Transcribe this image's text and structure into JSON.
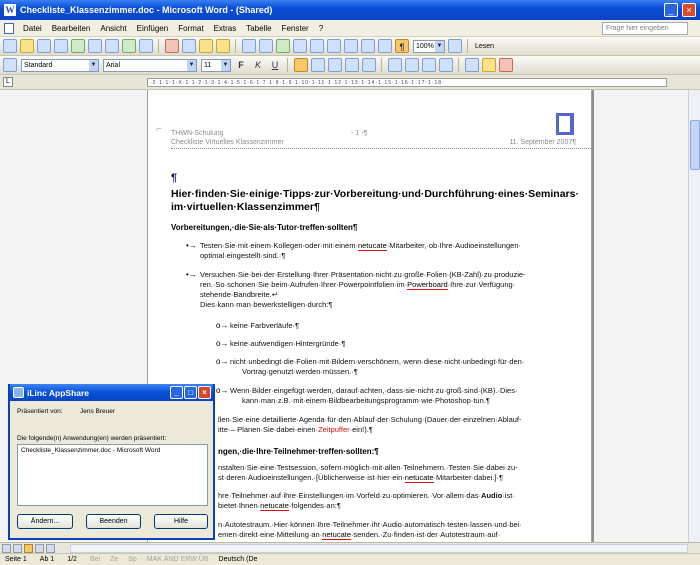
{
  "window": {
    "title": "Checkliste_Klassenzimmer.doc - Microsoft Word - (Shared)",
    "min_label": "_",
    "close_label": "×"
  },
  "menu": {
    "items": [
      "Datei",
      "Bearbeiten",
      "Ansicht",
      "Einfügen",
      "Format",
      "Extras",
      "Tabelle",
      "Fenster",
      "?"
    ],
    "help_placeholder": "Frage hier eingeben"
  },
  "toolbar": {
    "zoom": "100%",
    "read_label": "Lesen",
    "style": "Standard",
    "font": "Arial",
    "size": "11",
    "bold_label": "F",
    "italic_label": "K",
    "underline_label": "U"
  },
  "ruler": {
    "scale": "·2·1·1·1·X·1·1·2·1·3·1·4·1·5·1·6·1·7·1·8·1·9·1·10·1·11·1·12·1·13·1·14·1·15·1·16·1·17·1·18·"
  },
  "document": {
    "header_left1": "THWN-Schulung",
    "header_center1": "- 1 -¶",
    "header_left2": "Checkliste Virtuelles Klassenzimmer",
    "header_right2": "11. September 2007¶",
    "pilcrow": "¶",
    "heading": "Hier·finden·Sie·einige·Tipps·zur·Vorbereitung·und·Durchführung·eines·Seminars· im·virtuellen·Klassenzimmer¶",
    "section1": "Vorbereitungen,·die·Sie·als·Tutor·treffen·sollten¶",
    "b1_line1": "Testen·Sie·mit·einem·Kollegen·oder·mit·einem·",
    "b1_ul": "netucate",
    "b1_line1b": "·Mitarbeiter,·ob·Ihre·Audioeinstellungen·",
    "b1_line2": "optimal·eingestellt·sind.·¶",
    "b2_line1": "Versuchen·Sie·bei·der·Erstellung·Ihrer·Präsentation·nicht·zu·große·Folien·(KB-Zahl)·zu·produzie-",
    "b2_line2a": "ren.·So·schonen·Sie·beim·Aufrufen·Ihrer·Powerpointfolien·im·",
    "b2_ul": "Powerboard",
    "b2_line2b": "·Ihre·zur·Verfügung·",
    "b2_line3": "stehende·Bandbreite.↵",
    "b2_line4": "Dies·kann·man·bewerkstelligen·durch:¶",
    "s1": "keine·Farbverläufe·¶",
    "s2": "keine·aufwendigen·Hintergründe·¶",
    "s3_line1": "nicht·unbedingt·die·Folien·mit·Bildern·verschönern,·wenn·diese·nicht·unbedingt·für·den·",
    "s3_line2": "Vortrag·genutzt·werden·müssen.·¶",
    "s4_line1": "Wenn·Bilder·eingefügt·werden,·darauf·achten,·dass·sie·nicht·zu·groß·sind·(KB).·Dies·",
    "s4_line2": "kann·man·z.B.·mit·einem·Bildbearbeitungsprogramm·wie·Photoshop·tun.¶",
    "p1_line1": "llen·Sie·eine·detaillierte·Agenda·für·den·Ablauf·der·Schulung·(Dauer·der·einzelnen·Ablauf-",
    "p1_line2a": "itte·–·Planen·Sie·dabei·einen·",
    "p1_red": "Zeitpuffer",
    "p1_line2b": "·ein!).¶",
    "section2": "ngen,·die·Ihre·Teilnehmer·treffen·sollten:¶",
    "p2_line1": "nstalten·Sie·eine·Testsession,·sofern·möglich·mit·allen·Teilnehmern.·Testen·Sie·dabei·zu-",
    "p2_line2a": "st·deren·Audioeinstellungen.·[Üblicherweise·ist·hier·ein·",
    "p2_ul": "netucate",
    "p2_line2b": "·Mitarbeiter·dabei.]·¶",
    "p3_line1a": "hre·Teilnehmer·auf·ihre·Einstellungen·im·Vorfeld·zu·optimieren.·Vor·allem·das·",
    "p3_bold": "Audio",
    "p3_line1b": "·ist·",
    "p3_line2a": "bietet·Ihnen·",
    "p3_ul": "netucate",
    "p3_line2b": "·folgendes·an:¶",
    "p4_line1": "n·Autotestraum.·Hier·können·Ihre·Teilnehmer·ihr·Audio·automatisch·testen·lassen·und·bei·",
    "p4_line2a": "emen·direkt·eine·Mitteilung·an·",
    "p4_ul": "netucate",
    "p4_line2b": "·senden.·Zu·finden·ist·der·Autotestraum·auf·"
  },
  "dialog": {
    "title": "iLinc AppShare",
    "presenter_label": "Präsentiert von:",
    "presenter": "Jens Breuer",
    "list_label": "Die folgende(n) Anwendung(en) werden präsentiert:",
    "list_item": "Checkliste_Klassenzimmer.doc - Microsoft Word",
    "btn_change": "Ändern...",
    "btn_exit": "Beenden",
    "btn_help": "Hilfe"
  },
  "status": {
    "page": "Seite 1",
    "section": "Ab 1",
    "pages": "1/2",
    "at": "Bei",
    "line": "Ze",
    "col": "Sp",
    "modes": "MAK  ÄND  ERW  ÜB",
    "language": "Deutsch (De"
  },
  "colors": {
    "title_blue": "#0a4fd6",
    "bar_beige": "#ece9d8",
    "red_underline": "#dd1111"
  }
}
